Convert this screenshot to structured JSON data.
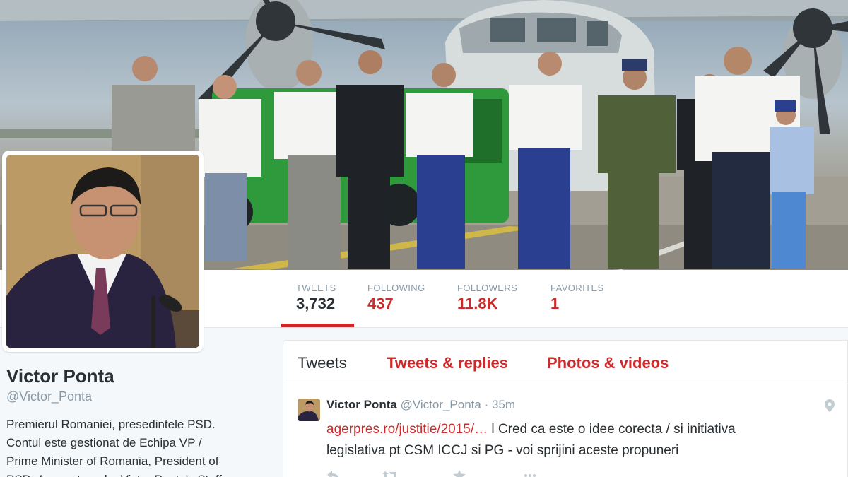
{
  "profile": {
    "name": "Victor Ponta",
    "handle": "@Victor_Ponta",
    "bio_lines": [
      "Premierul Romaniei, presedintele PSD.",
      "Contul este gestionat de Echipa VP /",
      "Prime Minister of Romania, President of",
      "PSD. Account run by Victor Ponta's Staff"
    ]
  },
  "stats": {
    "tweets": {
      "label": "TWEETS",
      "value": "3,732"
    },
    "following": {
      "label": "FOLLOWING",
      "value": "437"
    },
    "followers": {
      "label": "FOLLOWERS",
      "value": "11.8K"
    },
    "favorites": {
      "label": "FAVORITES",
      "value": "1"
    }
  },
  "tabs": {
    "tweets": "Tweets",
    "replies": "Tweets & replies",
    "media": "Photos & videos"
  },
  "tweet": {
    "name": "Victor Ponta",
    "handle": "@Victor_Ponta",
    "separator": "·",
    "time": "35m",
    "link": "agerpres.ro/justitie/2015/…",
    "text_after_link": " l Cred ca este o idee corecta / si initiativa",
    "text_line2": "legislativa pt CSM ICCJ si PG - voi sprijini aceste propuneri"
  },
  "icons": {
    "geo": "location-pin-icon",
    "reply": "reply-icon",
    "retweet": "retweet-icon",
    "favorite": "star-icon",
    "more": "more-icon"
  },
  "colors": {
    "accent": "#cc2b2b",
    "text": "#292f33",
    "muted": "#8899a6",
    "border": "#e1e8ed"
  }
}
